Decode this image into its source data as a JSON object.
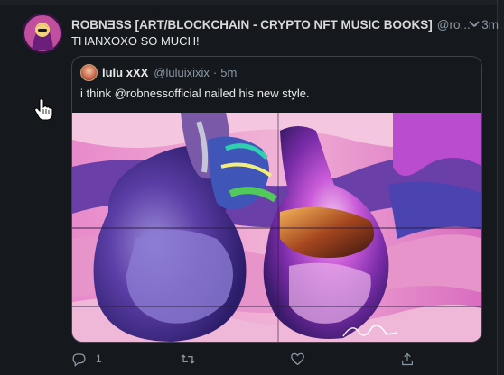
{
  "tweet": {
    "display_name": "ROBNƎSS [ART/BLOCKCHAIN - CRYPTO NFT MUSIC BOOKS]",
    "handle": "@ro...",
    "separator": "·",
    "time": "3m",
    "text": "THANXOXO SO MUCH!",
    "reply_count": "1"
  },
  "quoted": {
    "display_name": "lulu xXX",
    "handle": "@luluixixix",
    "separator": "·",
    "time": "5m",
    "text": "i think @robnessofficial nailed his new style."
  },
  "icons": {
    "caret": "chevron-down-icon",
    "reply": "reply-icon",
    "retweet": "retweet-icon",
    "like": "heart-icon",
    "share": "share-icon",
    "cursor": "hand-pointer-icon"
  },
  "colors": {
    "background": "#15181c",
    "text_primary": "#d9d9d9",
    "text_secondary": "#8b98a5",
    "border": "#3e4348",
    "artwork_pink": "#e07ac8",
    "artwork_purple": "#6b3fa8",
    "artwork_blue": "#3f55b8"
  }
}
